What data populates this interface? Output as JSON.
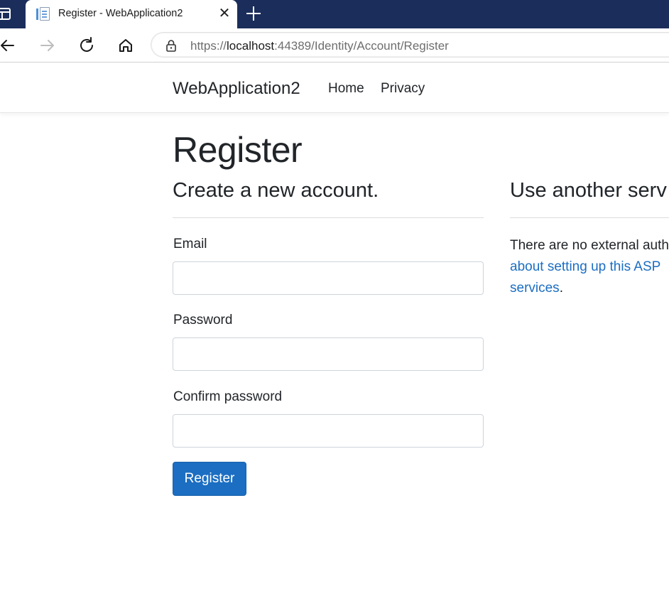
{
  "browser": {
    "tab_title": "Register - WebApplication2",
    "tab_close": "✕",
    "url_scheme": "https://",
    "url_host": "localhost",
    "url_rest": ":44389/Identity/Account/Register"
  },
  "site": {
    "brand": "WebApplication2",
    "nav": [
      {
        "label": "Home"
      },
      {
        "label": "Privacy"
      }
    ]
  },
  "page": {
    "title": "Register",
    "form_heading": "Create a new account.",
    "external_heading": "Use another serv",
    "fields": {
      "email": {
        "label": "Email",
        "value": ""
      },
      "password": {
        "label": "Password",
        "value": ""
      },
      "confirm": {
        "label": "Confirm password",
        "value": ""
      }
    },
    "submit_label": "Register",
    "external_text_1": "There are no external auth",
    "external_link_1": "about setting up this ASP",
    "external_link_2": "services",
    "external_text_end": "."
  },
  "colors": {
    "tabstrip": "#1b2d5a",
    "primary": "#1b6ec2",
    "text": "#212529"
  }
}
